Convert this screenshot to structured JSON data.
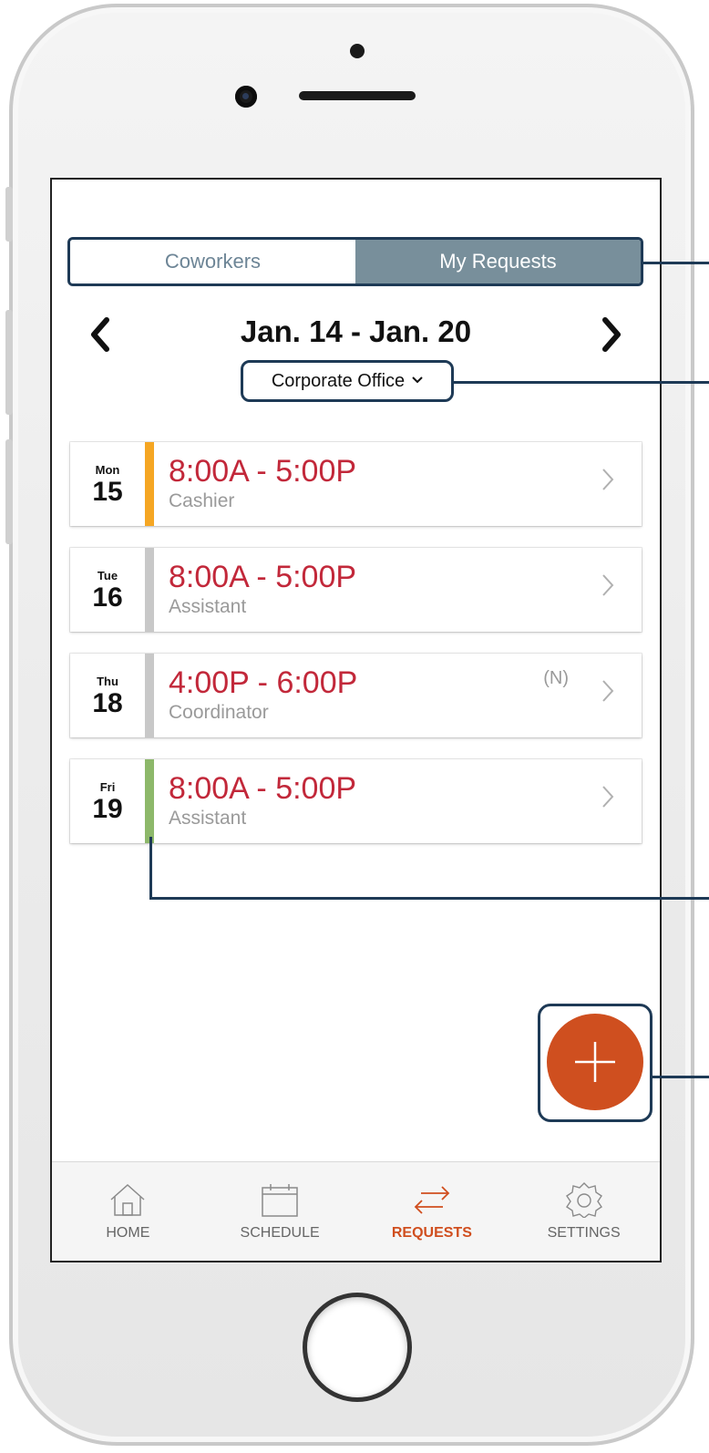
{
  "segmented": {
    "coworkers": "Coworkers",
    "my_requests": "My Requests",
    "selected": "My Requests"
  },
  "week": {
    "range": "Jan. 14 - Jan. 20",
    "prev": "<",
    "next": ">"
  },
  "location": {
    "label": "Corporate Office",
    "chevron": "⌄"
  },
  "shifts": [
    {
      "dow": "Mon",
      "day": "15",
      "time": "8:00A - 5:00P",
      "role": "Cashier",
      "note": "",
      "color": "#f5a623"
    },
    {
      "dow": "Tue",
      "day": "16",
      "time": "8:00A - 5:00P",
      "role": "Assistant",
      "note": "",
      "color": "#c8c8c8"
    },
    {
      "dow": "Thu",
      "day": "18",
      "time": "4:00P - 6:00P",
      "role": "Coordinator",
      "note": "(N)",
      "color": "#c8c8c8"
    },
    {
      "dow": "Fri",
      "day": "19",
      "time": "8:00A - 5:00P",
      "role": "Assistant",
      "note": "",
      "color": "#8db86a"
    }
  ],
  "fab": {
    "label": "+",
    "icon": "plus-icon",
    "color": "#cf4f1f"
  },
  "tabbar": [
    {
      "label": "HOME",
      "icon": "home-icon",
      "active": false
    },
    {
      "label": "SCHEDULE",
      "icon": "calendar-icon",
      "active": false
    },
    {
      "label": "REQUESTS",
      "icon": "swap-arrows-icon",
      "active": true
    },
    {
      "label": "SETTINGS",
      "icon": "gear-icon",
      "active": false
    }
  ],
  "colors": {
    "accent": "#d04e1e",
    "time_text": "#c2283a",
    "callout": "#1e3a56"
  }
}
